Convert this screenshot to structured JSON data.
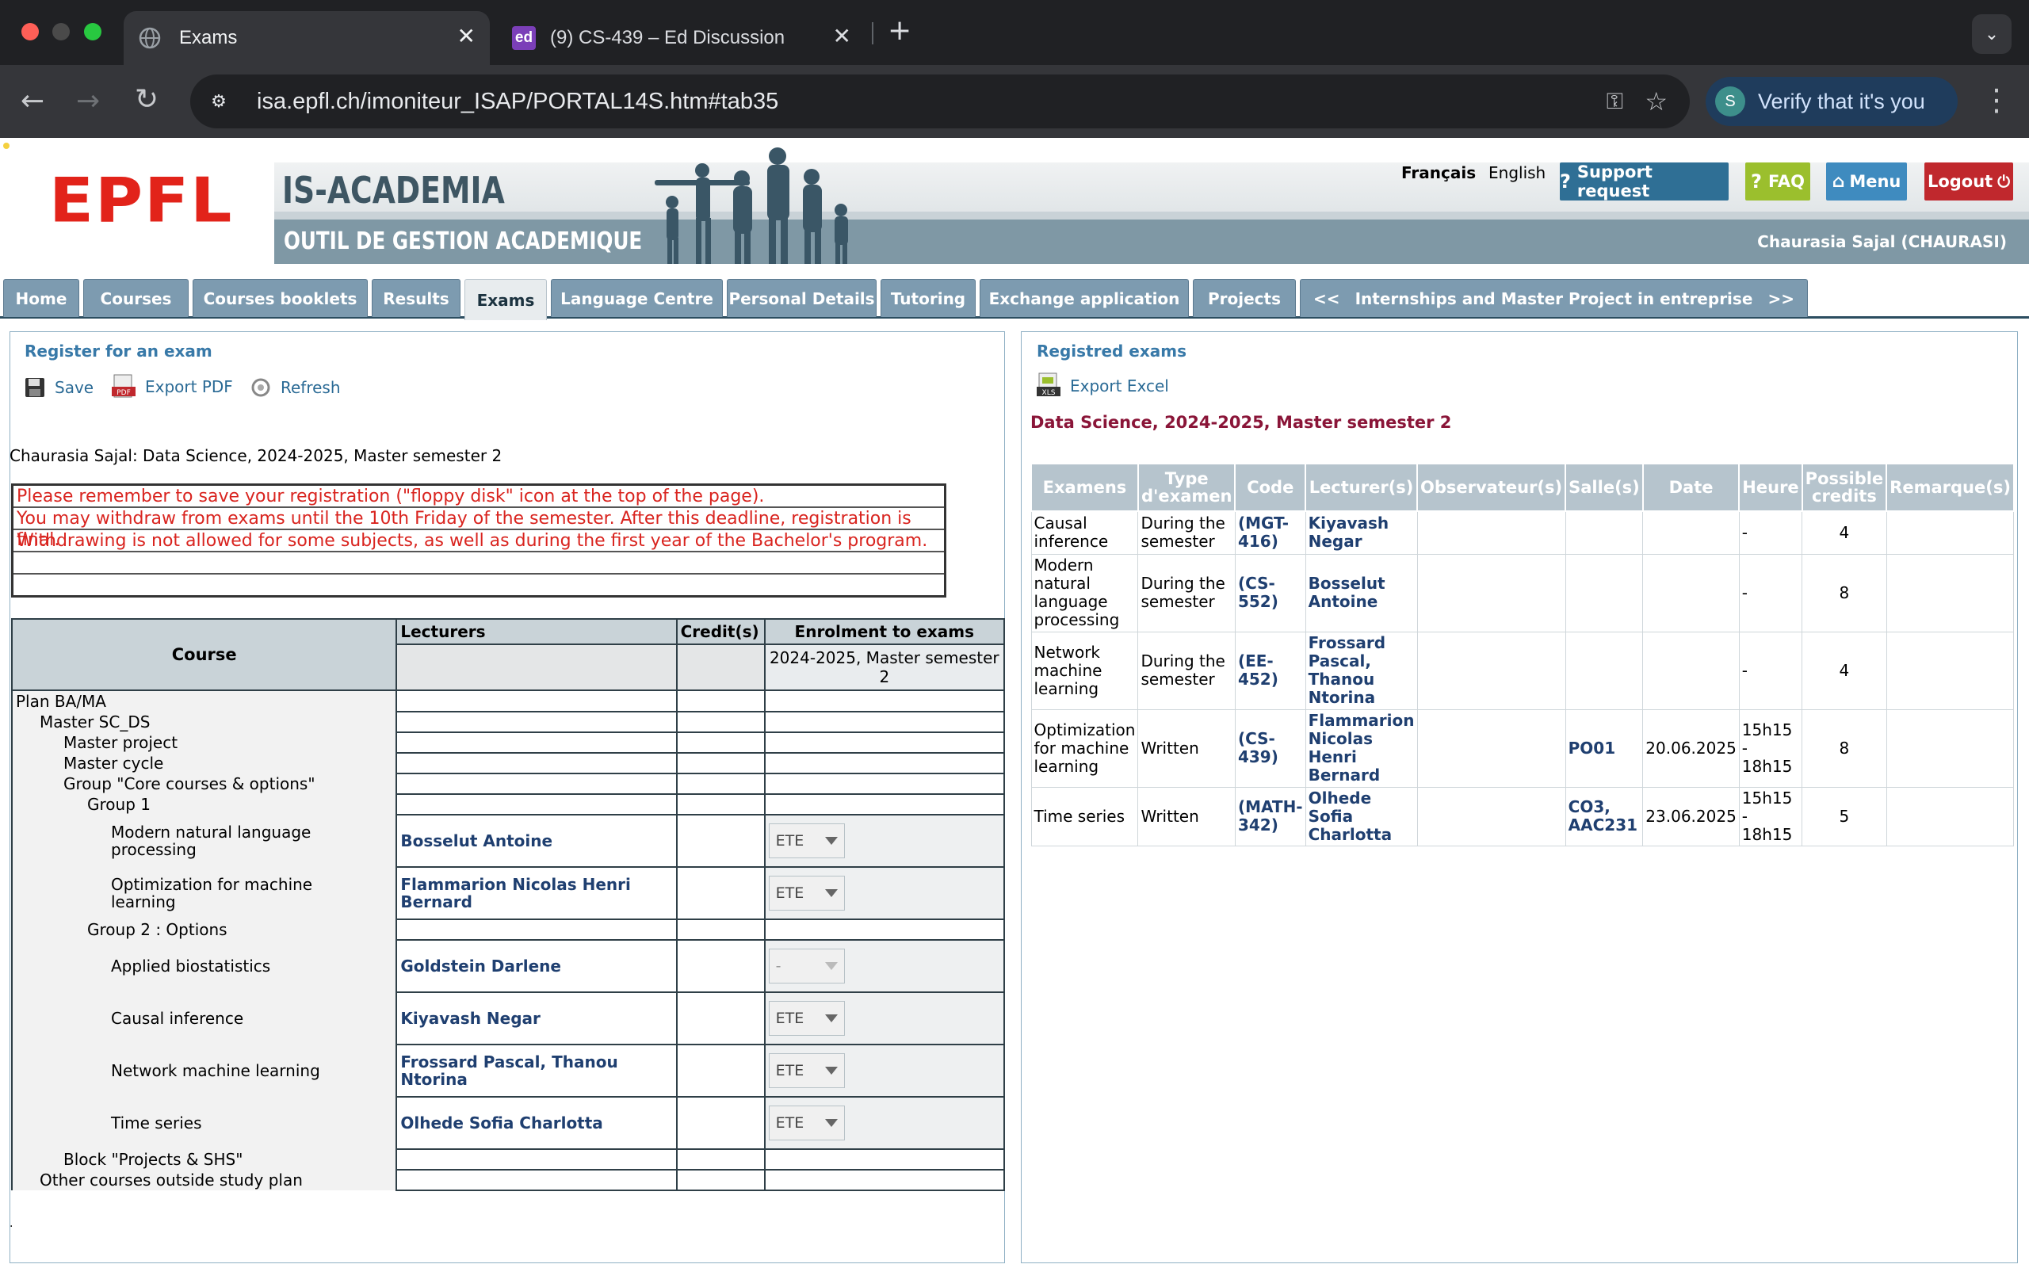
{
  "browser": {
    "tabs": [
      {
        "title": "Exams",
        "active": true,
        "icon": "globe-icon"
      },
      {
        "title": "(9) CS-439 – Ed Discussion",
        "active": false,
        "icon": "ed-icon",
        "icon_text": "ed"
      }
    ],
    "url": "isa.epfl.ch/imoniteur_ISAP/PORTAL14S.htm#tab35",
    "verify_label": "Verify that it's you",
    "colors": {
      "close": "#ff5f57",
      "minimize": "#febc2e",
      "maximize": "#28c840"
    }
  },
  "header": {
    "logo": "EPFL",
    "banner_title": "IS-ACADEMIA",
    "banner_subtitle": "OUTIL DE GESTION ACADEMIQUE",
    "lang_fr": "Français",
    "lang_en": "English",
    "support": "Support request",
    "faq": "FAQ",
    "menu": "Menu",
    "logout": "Logout",
    "user": "Chaurasia Sajal (CHAURASI)",
    "colors": {
      "support": "#2f6f95",
      "faq": "#9bbf2d",
      "menu": "#3f8bbf",
      "logout": "#c0282d",
      "logo": "#e2231a"
    }
  },
  "nav": {
    "tabs": [
      "Home",
      "Courses",
      "Courses booklets",
      "Results",
      "Exams",
      "Language Centre",
      "Personal Details",
      "Tutoring",
      "Exchange application",
      "Projects"
    ],
    "scroll_left": "<<",
    "extra_tab": "Internships and Master Project in entreprise",
    "scroll_right": ">>",
    "selected": "Exams"
  },
  "left": {
    "title": "Register for an exam",
    "save": "Save",
    "export_pdf": "Export PDF",
    "refresh": "Refresh",
    "student_line": "Chaurasia  Sajal:  Data Science, 2024-2025, Master semester 2",
    "messages": [
      "Please remember to save your registration (\"floppy disk\" icon at the top of the page).",
      "You may withdraw from exams until the 10th Friday of the semester. After this deadline, registration is final.",
      "Withdrawing is not allowed for some subjects, as well as during the first year of the Bachelor's program."
    ],
    "table": {
      "h_course": "Course",
      "h_lecturers": "Lecturers",
      "h_credits": "Credit(s)",
      "h_enrol": "Enrolment to exams",
      "h_period": "2024-2025, Master semester 2",
      "rows": [
        {
          "label": "Plan BA/MA",
          "level": 0
        },
        {
          "label": "Master SC_DS",
          "level": 1
        },
        {
          "label": "Master project",
          "level": 2
        },
        {
          "label": "Master cycle",
          "level": 2
        },
        {
          "label": "Group \"Core courses & options\"",
          "level": 3
        },
        {
          "label": "Group 1",
          "level": 4
        },
        {
          "label": "Modern natural language processing",
          "level": 5,
          "lecturer": "Bosselut Antoine",
          "select": "ETE"
        },
        {
          "label": "Optimization for machine learning",
          "level": 5,
          "lecturer": "Flammarion Nicolas Henri Bernard",
          "select": "ETE"
        },
        {
          "label": "Group 2 : Options",
          "level": 4
        },
        {
          "label": "Applied biostatistics",
          "level": 5,
          "lecturer": "Goldstein Darlene",
          "select": "-",
          "disabled": true
        },
        {
          "label": "Causal inference",
          "level": 5,
          "lecturer": "Kiyavash Negar",
          "select": "ETE"
        },
        {
          "label": "Network machine learning",
          "level": 5,
          "lecturer": "Frossard Pascal, Thanou Ntorina",
          "select": "ETE"
        },
        {
          "label": "Time series",
          "level": 5,
          "lecturer": "Olhede Sofia Charlotta",
          "select": "ETE"
        },
        {
          "label": "Block \"Projects & SHS\"",
          "level": 3
        },
        {
          "label": "Other courses outside study plan",
          "level": 1
        }
      ]
    }
  },
  "right": {
    "title": "Registred exams",
    "export_excel": "Export Excel",
    "program": "Data Science, 2024-2025, Master semester 2",
    "headers": [
      "Examens",
      "Type d'examen",
      "Code",
      "Lecturer(s)",
      "Observateur(s)",
      "Salle(s)",
      "Date",
      "Heure",
      "Possible credits",
      "Remarque(s)"
    ],
    "rows": [
      {
        "exam": "Causal inference",
        "type": "During the semester",
        "code": "(MGT-416)",
        "lecturer": "Kiyavash Negar",
        "observer": "",
        "room": "",
        "date": "",
        "time": "-",
        "credits": "4",
        "remark": ""
      },
      {
        "exam": "Modern natural language processing",
        "type": "During the semester",
        "code": "(CS-552)",
        "lecturer": "Bosselut Antoine",
        "observer": "",
        "room": "",
        "date": "",
        "time": "-",
        "credits": "8",
        "remark": ""
      },
      {
        "exam": "Network machine learning",
        "type": "During the semester",
        "code": "(EE-452)",
        "lecturer": "Frossard Pascal, Thanou Ntorina",
        "observer": "",
        "room": "",
        "date": "",
        "time": "-",
        "credits": "4",
        "remark": ""
      },
      {
        "exam": "Optimization for machine learning",
        "type": "Written",
        "code": "(CS-439)",
        "lecturer": "Flammarion Nicolas Henri Bernard",
        "observer": "",
        "room": "PO01",
        "date": "20.06.2025",
        "time": "15h15 - 18h15",
        "credits": "8",
        "remark": ""
      },
      {
        "exam": "Time series",
        "type": "Written",
        "code": "(MATH-342)",
        "lecturer": "Olhede Sofia Charlotta",
        "observer": "",
        "room": "CO3, AAC231",
        "date": "23.06.2025",
        "time": "15h15 - 18h15",
        "credits": "5",
        "remark": ""
      }
    ]
  }
}
